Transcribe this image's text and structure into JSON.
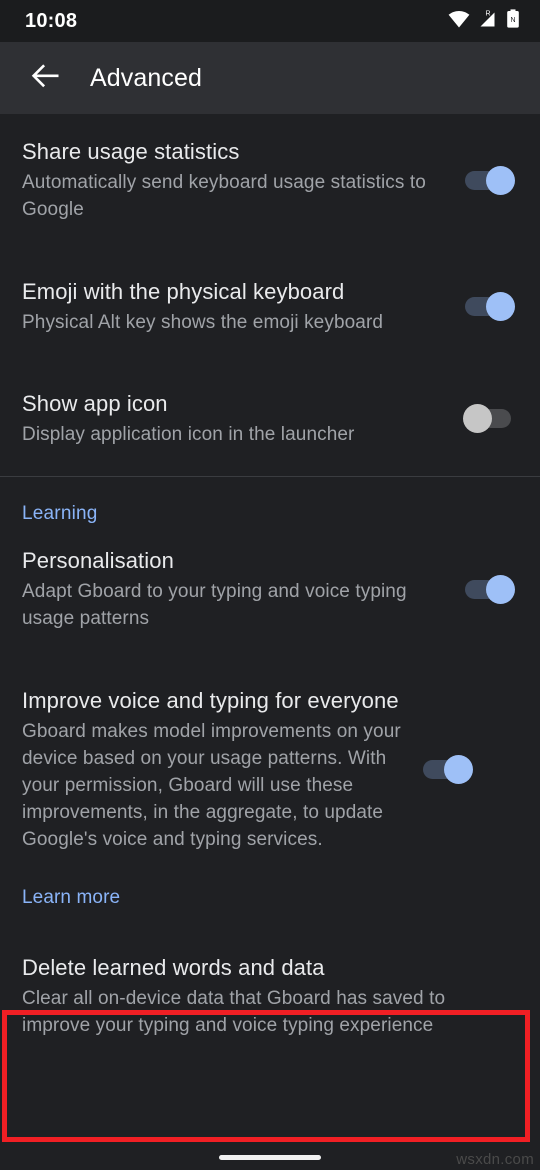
{
  "status_bar": {
    "time": "10:08",
    "icons": [
      "wifi-icon",
      "cellular-signal-roaming-icon",
      "battery-icon"
    ]
  },
  "app_bar": {
    "back_icon": "arrow-back-icon",
    "title": "Advanced"
  },
  "settings": [
    {
      "key": "share_usage_statistics",
      "title": "Share usage statistics",
      "summary": "Automatically send keyboard usage statistics to Google",
      "switch_state": "on"
    },
    {
      "key": "emoji_physical_keyboard",
      "title": "Emoji with the physical keyboard",
      "summary": "Physical Alt key shows the emoji keyboard",
      "switch_state": "on"
    },
    {
      "key": "show_app_icon",
      "title": "Show app icon",
      "summary": "Display application icon in the launcher",
      "switch_state": "off"
    }
  ],
  "learning_section": {
    "header": "Learning",
    "items": [
      {
        "key": "personalisation",
        "title": "Personalisation",
        "summary": "Adapt Gboard to your typing and voice typing usage patterns",
        "switch_state": "on"
      },
      {
        "key": "improve_voice_and_typing",
        "title": "Improve voice and typing for everyone",
        "summary": "Gboard makes model improvements on your device based on your usage patterns. With your permission, Gboard will use these improvements, in the aggregate, to update Google's voice and typing services.",
        "switch_state": "on"
      }
    ],
    "learn_more_label": "Learn more",
    "delete_item": {
      "key": "delete_learned_words_and_data",
      "title": "Delete learned words and data",
      "summary": "Clear all on-device data that Gboard has saved to improve your typing and voice typing experience"
    }
  },
  "highlight": {
    "color": "#f01f24",
    "target": "delete-learned-words-and-data-row"
  },
  "colors": {
    "background": "#1f2023",
    "app_bar": "#2f3034",
    "status_bar": "#1b1c1e",
    "accent_blue": "#8ab4f8",
    "switch_on_thumb": "#9ec0f7",
    "switch_on_track": "#3f4a5d",
    "switch_off_thumb": "#c6c6c6",
    "switch_off_track": "#4a4b4e",
    "title_text": "#e9eaec",
    "summary_text": "#a0a3a8"
  },
  "nav_bar": {
    "gesture_pill": "home-gesture-pill"
  },
  "watermark": {
    "text": "wsxdn.com"
  }
}
